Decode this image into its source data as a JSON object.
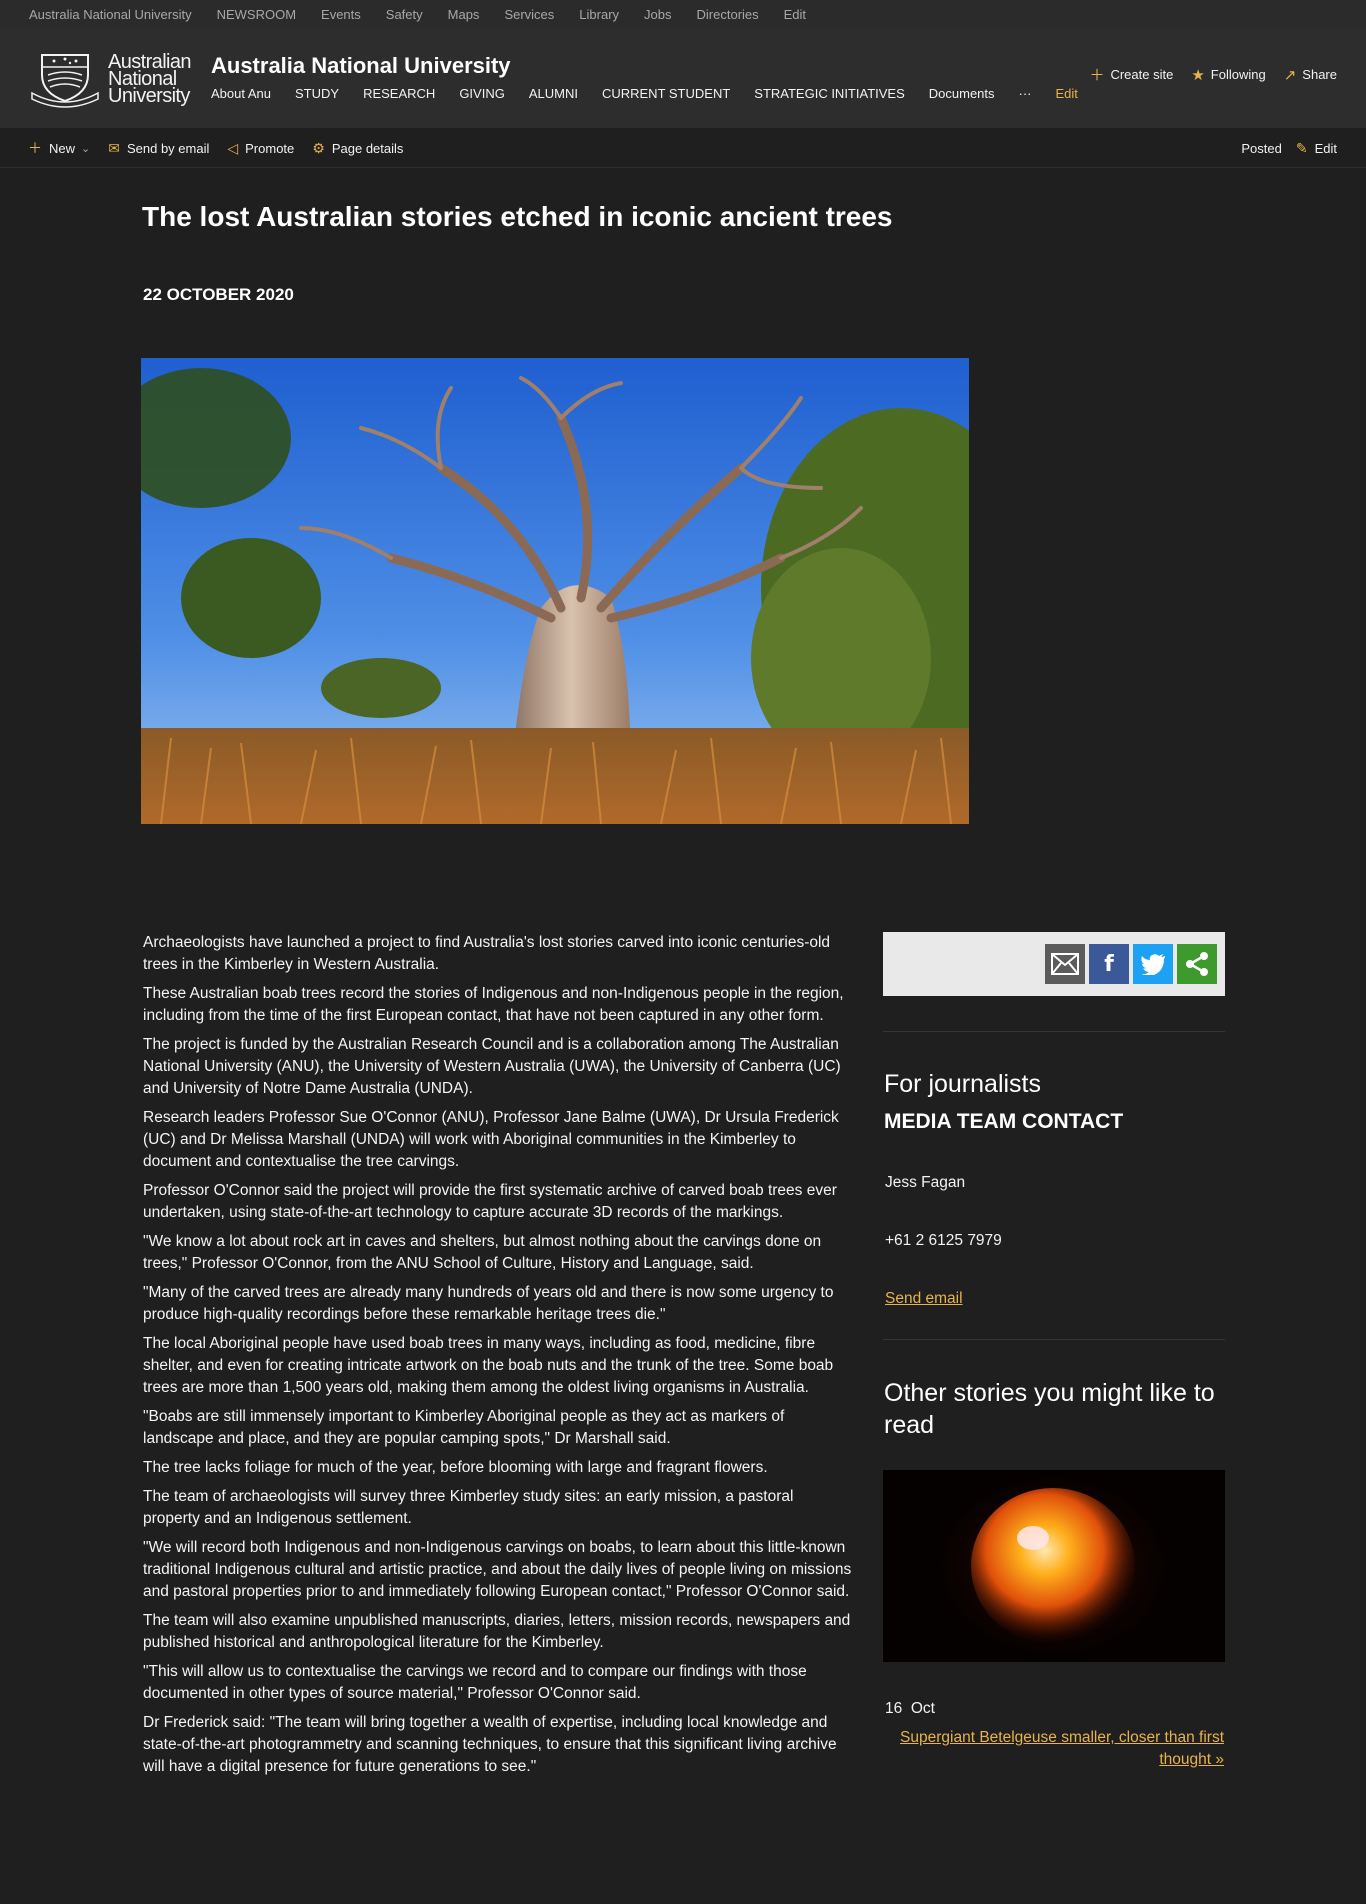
{
  "suite_bar": {
    "links": [
      "Australia National University",
      "NEWSROOM",
      "Events",
      "Safety",
      "Maps",
      "Services",
      "Library",
      "Jobs",
      "Directories",
      "Edit"
    ]
  },
  "header": {
    "logo_text_line1": "Australian",
    "logo_text_line2": "National",
    "logo_text_line3": "University",
    "site_title": "Australia National University",
    "nav": [
      "About Anu",
      "STUDY",
      "RESEARCH",
      "GIVING",
      "ALUMNI",
      "CURRENT STUDENT",
      "STRATEGIC INITIATIVES",
      "Documents"
    ],
    "nav_more": "···",
    "nav_edit": "Edit",
    "actions": {
      "create_site": "Create site",
      "following": "Following",
      "share": "Share"
    }
  },
  "command_bar": {
    "new": "New",
    "send_by_email": "Send by email",
    "promote": "Promote",
    "page_details": "Page details",
    "status": "Posted",
    "edit": "Edit"
  },
  "article": {
    "title": "The lost Australian stories etched in iconic ancient trees",
    "date": "22 OCTOBER 2020",
    "paragraphs": [
      "Archaeologists have launched a project to find Australia's lost stories carved into iconic centuries-old trees in the Kimberley in Western Australia.",
      "These Australian boab trees record the stories of Indigenous and non-Indigenous people in the region, including from the time of the first European contact, that have not been captured in any other form.",
      "The project is funded by the Australian Research Council and is a collaboration among The Australian National University (ANU), the University of Western Australia (UWA), the University of Canberra (UC) and University of Notre Dame Australia (UNDA).",
      "Research leaders Professor Sue O'Connor (ANU), Professor Jane Balme (UWA), Dr Ursula Frederick (UC) and Dr Melissa Marshall (UNDA) will work with Aboriginal communities in the Kimberley to document and contextualise the tree carvings.",
      "Professor O'Connor said the project will provide the first systematic archive of carved boab trees ever undertaken, using state-of-the-art technology to capture accurate 3D records of the markings.",
      "\"We know a lot about rock art in caves and shelters, but almost nothing about the carvings done on trees,\" Professor O'Connor, from the ANU School of Culture, History and Language, said.",
      "\"Many of the carved trees are already many hundreds of years old and there is now some urgency to produce high-quality recordings before these remarkable heritage trees die.\"",
      "The local Aboriginal people have used boab trees in many ways, including as food, medicine, fibre shelter, and even for creating intricate artwork on the boab nuts and the trunk of the tree. Some boab trees are more than 1,500 years old, making them among the oldest living organisms in Australia.",
      "\"Boabs are still immensely important to Kimberley Aboriginal people as they act as markers of landscape and place, and they are popular camping spots,\" Dr Marshall said.",
      "The tree lacks foliage for much of the year, before blooming with large and fragrant flowers.",
      "The team of archaeologists will survey three Kimberley study sites: an early mission, a pastoral property and an Indigenous settlement.",
      "\"We will record both Indigenous and non-Indigenous carvings on boabs, to learn about this little-known traditional Indigenous cultural and artistic practice, and about the daily lives of people living on missions and pastoral properties prior to and immediately following European contact,\" Professor O'Connor said.",
      "The team will also examine unpublished manuscripts, diaries, letters, mission records, newspapers and published historical and anthropological literature for the Kimberley.",
      "\"This will allow us to contextualise the carvings we record and to compare our findings with those documented in other types of source material,\" Professor O'Connor said.",
      "Dr Frederick said: \"The team will bring together a wealth of expertise, including local knowledge and state-of-the-art photogrammetry and scanning techniques, to ensure that this significant living archive will have a digital presence for future generations to see.\""
    ]
  },
  "sidebar": {
    "share_icons": [
      "email-icon",
      "facebook-icon",
      "twitter-icon",
      "share-icon"
    ],
    "journalists_heading": "For journalists",
    "media_heading": "MEDIA TEAM CONTACT",
    "contact_name": "Jess Fagan",
    "contact_phone": "+61 2 6125 7979",
    "contact_email_label": "Send email",
    "other_heading": "Other stories you might like to read",
    "story": {
      "day": "16",
      "month": "Oct",
      "title": "Supergiant Betelgeuse smaller, closer than first thought »"
    }
  },
  "colors": {
    "accent": "#e8b34a",
    "page_bg": "#1f1f1f",
    "header_bg": "#2d2d2d",
    "suite_bar_bg": "#2b2b2b"
  }
}
